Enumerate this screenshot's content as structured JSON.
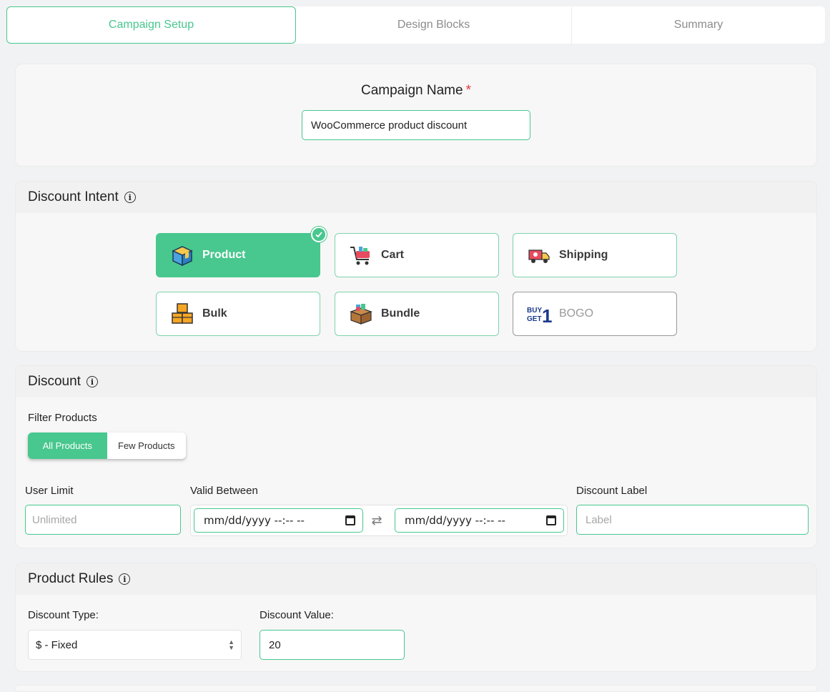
{
  "tabs": [
    {
      "label": "Campaign Setup",
      "active": true
    },
    {
      "label": "Design Blocks",
      "active": false
    },
    {
      "label": "Summary",
      "active": false
    }
  ],
  "campaign": {
    "label": "Campaign Name",
    "required_mark": "*",
    "value": "WooCommerce product discount"
  },
  "intent": {
    "title": "Discount Intent",
    "info_icon": "info-icon",
    "options": [
      {
        "label": "Product",
        "icon": "product-box-icon",
        "selected": true
      },
      {
        "label": "Cart",
        "icon": "shopping-cart-icon",
        "selected": false
      },
      {
        "label": "Shipping",
        "icon": "delivery-truck-icon",
        "selected": false
      },
      {
        "label": "Bulk",
        "icon": "stacked-boxes-icon",
        "selected": false
      },
      {
        "label": "Bundle",
        "icon": "bundle-box-icon",
        "selected": false
      },
      {
        "label": "BOGO",
        "icon": "buy-get-one-icon",
        "selected": false,
        "disabled": true,
        "icon_text": [
          "BUY",
          "GET",
          "1"
        ]
      }
    ]
  },
  "discount": {
    "title": "Discount",
    "filter_label": "Filter Products",
    "filter_options": [
      "All Products",
      "Few Products"
    ],
    "filter_selected": "All Products",
    "user_limit_label": "User Limit",
    "user_limit_placeholder": "Unlimited",
    "valid_between_label": "Valid Between",
    "date_start_placeholder": "mm/dd/yyyy --:-- --",
    "date_end_placeholder": "mm/dd/yyyy --:-- --",
    "swap_icon": "swap-arrows-icon",
    "discount_label_label": "Discount Label",
    "discount_label_placeholder": "Label"
  },
  "rules": {
    "title": "Product Rules",
    "type_label": "Discount Type:",
    "type_value": "$ - Fixed",
    "value_label": "Discount Value:",
    "value": "20"
  },
  "colors": {
    "accent": "#48c78e",
    "required": "#e0393e"
  }
}
